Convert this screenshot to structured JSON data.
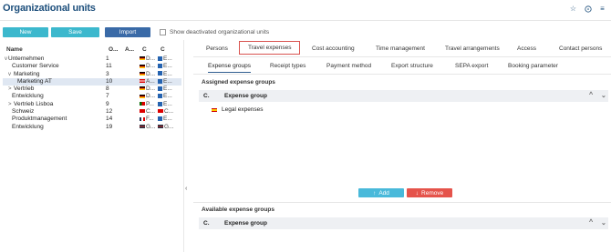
{
  "header": {
    "title": "Organizational units",
    "icons": [
      "star-icon",
      "help-icon",
      "menu-icon"
    ]
  },
  "toolbar": {
    "new_label": "New",
    "save_label": "Save",
    "import_label": "Import",
    "show_deactivated_label": "Show deactivated organizational units",
    "show_deactivated_checked": false
  },
  "tree": {
    "columns": [
      "Name",
      "O...",
      "A...",
      "C",
      "C"
    ],
    "rows": [
      {
        "name": "Unternehmen",
        "expander": "v",
        "number": "1",
        "c1": "D...",
        "c2": "E...",
        "flag": "de"
      },
      {
        "name": "Customer Service",
        "expander": "",
        "number": "11",
        "c1": "D...",
        "c2": "E...",
        "flag": "de"
      },
      {
        "name": "Marketing",
        "expander": "v",
        "number": "3",
        "c1": "D...",
        "c2": "E...",
        "flag": "de"
      },
      {
        "name": "Marketing AT",
        "expander": "",
        "number": "10",
        "c1": "A...",
        "c2": "E...",
        "flag": "at",
        "selected": true
      },
      {
        "name": "Vertrieb",
        "expander": ">",
        "number": "8",
        "c1": "D...",
        "c2": "E...",
        "flag": "de"
      },
      {
        "name": "Entwicklung",
        "expander": "",
        "number": "7",
        "c1": "D...",
        "c2": "E...",
        "flag": "de"
      },
      {
        "name": "Vertrieb Lisboa",
        "expander": ">",
        "number": "9",
        "c1": "P...",
        "c2": "E...",
        "flag": "pt"
      },
      {
        "name": "Schweiz",
        "expander": "",
        "number": "12",
        "c1": "C...",
        "c2": "C...",
        "flag": "ch"
      },
      {
        "name": "Produktmanagement",
        "expander": "",
        "number": "14",
        "c1": "F...",
        "c2": "E...",
        "flag": "fr"
      },
      {
        "name": "Entwicklung",
        "expander": "",
        "number": "19",
        "c1": "G...",
        "c2": "G...",
        "flag": "gb"
      }
    ]
  },
  "tabs": [
    "Persons",
    "Travel expenses",
    "Cost accounting",
    "Time management",
    "Travel arrangements",
    "Access",
    "Contact persons"
  ],
  "active_tab": "Travel expenses",
  "subtabs": [
    "Expense groups",
    "Receipt types",
    "Payment method",
    "Export structure",
    "SEPA export",
    "Booking parameter"
  ],
  "active_subtab": "Expense groups",
  "assigned": {
    "title": "Assigned expense groups",
    "col_c": "C.",
    "col_group": "Expense group",
    "rows": [
      {
        "label": "Legal expenses",
        "flag": "es"
      }
    ]
  },
  "actions": {
    "add_label": "Add",
    "remove_label": "Remove"
  },
  "available": {
    "title": "Available expense groups",
    "col_c": "C.",
    "col_group": "Expense group"
  },
  "colors": {
    "title": "#1d4f7c",
    "new_save": "#3cb8cd",
    "import": "#3a6aa7",
    "add": "#49b9da",
    "remove": "#e5534b",
    "active_tab_border": "#d9534f"
  }
}
